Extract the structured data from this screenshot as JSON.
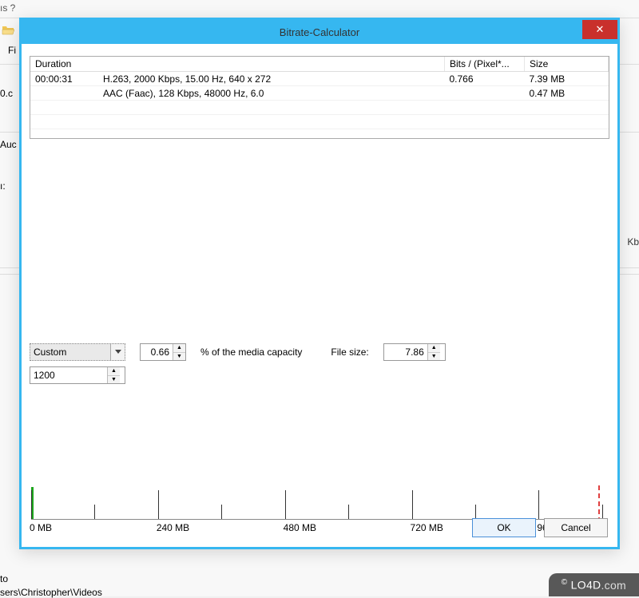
{
  "background": {
    "menu_fragment": "ıs    ?",
    "fi": "Fi",
    "aud": "Auc",
    "colon": "ı:",
    "kb": "Kb",
    "to": "to",
    "path": "sers\\Christopher\\Videos",
    "ext": "0.c"
  },
  "dialog": {
    "title": "Bitrate-Calculator",
    "close_icon": "✕"
  },
  "table": {
    "headers": {
      "duration": "Duration",
      "bits": "Bits / (Pixel*...",
      "size": "Size"
    },
    "rows": [
      {
        "duration": "00:00:31",
        "desc": "H.263, 2000 Kbps, 15.00 Hz, 640 x 272",
        "bits": "0.766",
        "size": "7.39 MB"
      },
      {
        "duration": "",
        "desc": "AAC (Faac), 128 Kbps, 48000 Hz, 6.0",
        "bits": "",
        "size": "0.47 MB"
      }
    ]
  },
  "controls": {
    "preset_label": "Custom",
    "bitrate_value": "1200",
    "pct_value": "0.66",
    "pct_label": "% of the media capacity",
    "filesize_label": "File size:",
    "filesize_value": "7.86"
  },
  "ruler": {
    "labels": [
      "0 MB",
      "240 MB",
      "480 MB",
      "720 MB",
      "960 MB"
    ]
  },
  "buttons": {
    "ok": "OK",
    "cancel": "Cancel"
  },
  "watermark": {
    "text": "LO4D",
    "suffix": ".com"
  }
}
